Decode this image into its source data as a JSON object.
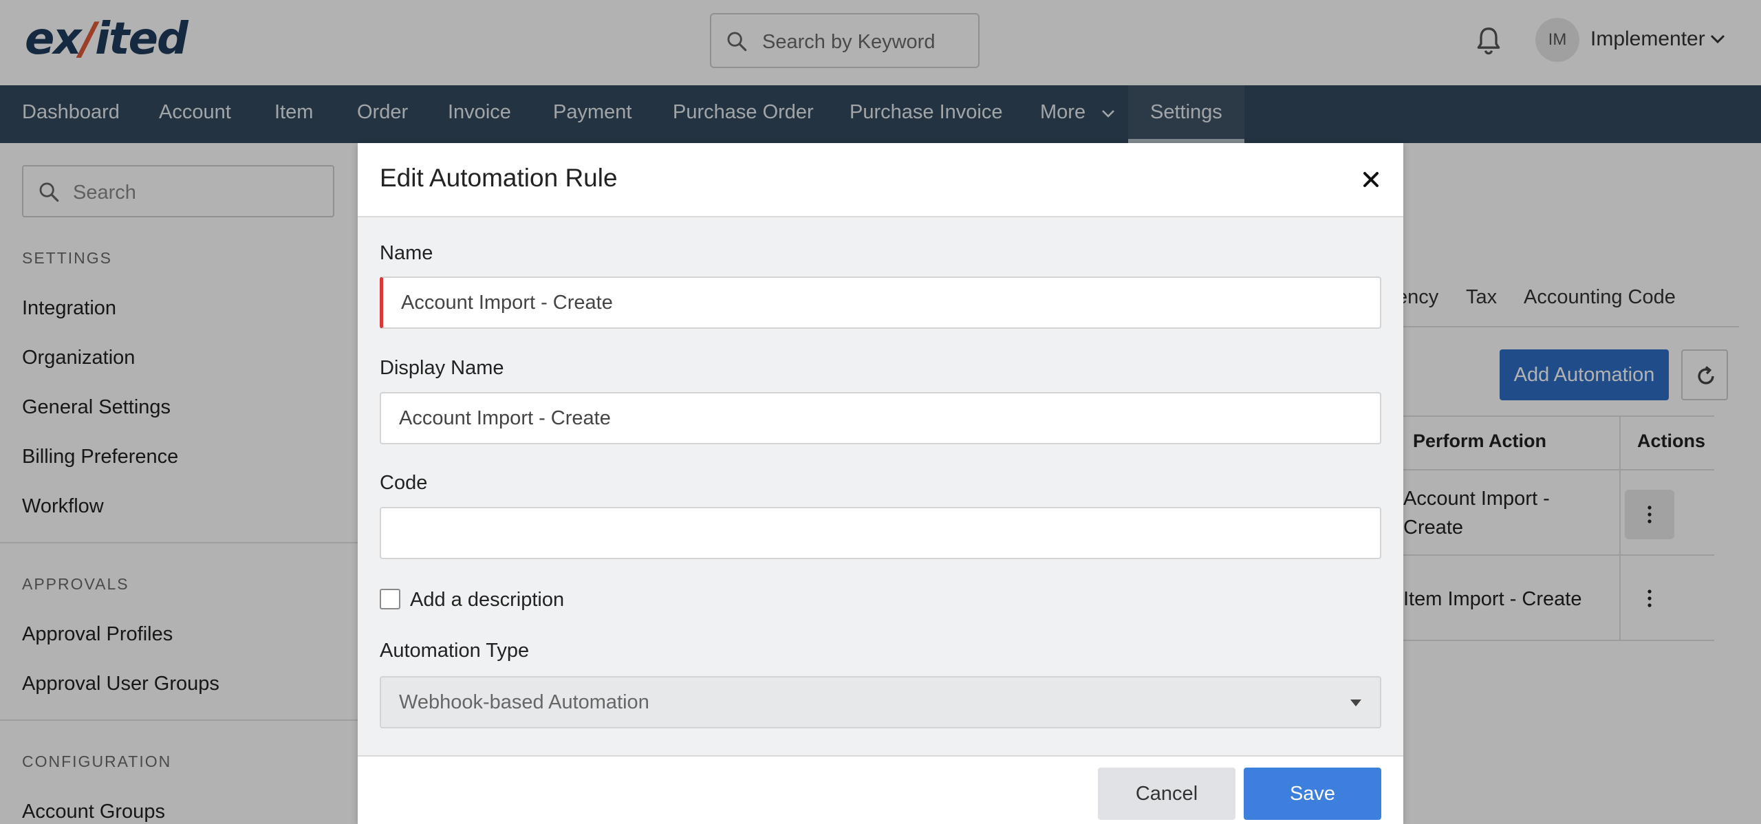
{
  "brand": {
    "logo_text_pre": "ex",
    "logo_text_accent": "∕",
    "logo_text_post": "ited"
  },
  "header": {
    "search_placeholder": "Search by Keyword",
    "user_initials": "IM",
    "user_name": "Implementer"
  },
  "nav": {
    "items": [
      {
        "label": "Dashboard"
      },
      {
        "label": "Account"
      },
      {
        "label": "Item"
      },
      {
        "label": "Order"
      },
      {
        "label": "Invoice"
      },
      {
        "label": "Payment"
      },
      {
        "label": "Purchase Order"
      },
      {
        "label": "Purchase Invoice"
      },
      {
        "label": "More"
      },
      {
        "label": "Settings"
      }
    ],
    "active": "Settings"
  },
  "sidebar": {
    "search_placeholder": "Search",
    "sections": [
      {
        "title": "SETTINGS",
        "items": [
          "Integration",
          "Organization",
          "General Settings",
          "Billing Preference",
          "Workflow"
        ]
      },
      {
        "title": "APPROVALS",
        "items": [
          "Approval Profiles",
          "Approval User Groups"
        ]
      },
      {
        "title": "CONFIGURATION",
        "items": [
          "Account Groups"
        ]
      }
    ]
  },
  "page": {
    "tabs": [
      "ency",
      "Tax",
      "Accounting Code"
    ],
    "add_button": "Add Automation",
    "table": {
      "headers": [
        "Perform Action",
        "Actions"
      ],
      "rows": [
        {
          "perform_action_line1": "Account Import -",
          "perform_action_line2": "Create"
        },
        {
          "perform_action_line1": "Item Import - Create",
          "perform_action_line2": ""
        }
      ]
    }
  },
  "modal": {
    "title": "Edit Automation Rule",
    "name_label": "Name",
    "name_value": "Account Import - Create",
    "display_name_label": "Display Name",
    "display_name_value": "Account Import - Create",
    "code_label": "Code",
    "code_value": "",
    "description_checkbox_label": "Add a description",
    "description_checked": false,
    "automation_type_label": "Automation Type",
    "automation_type_value": "Webhook-based Automation",
    "cancel_label": "Cancel",
    "save_label": "Save"
  },
  "colors": {
    "nav_bg": "#34495e",
    "primary": "#2f6fc6",
    "save_button": "#3d7fdc",
    "error_accent": "#d93838",
    "logo_accent": "#e0593a",
    "logo_main": "#1f3b5c"
  },
  "icons": [
    "search-icon",
    "bell-icon",
    "chevron-down-icon",
    "refresh-icon",
    "kebab-icon",
    "close-icon",
    "caret-down-icon"
  ]
}
